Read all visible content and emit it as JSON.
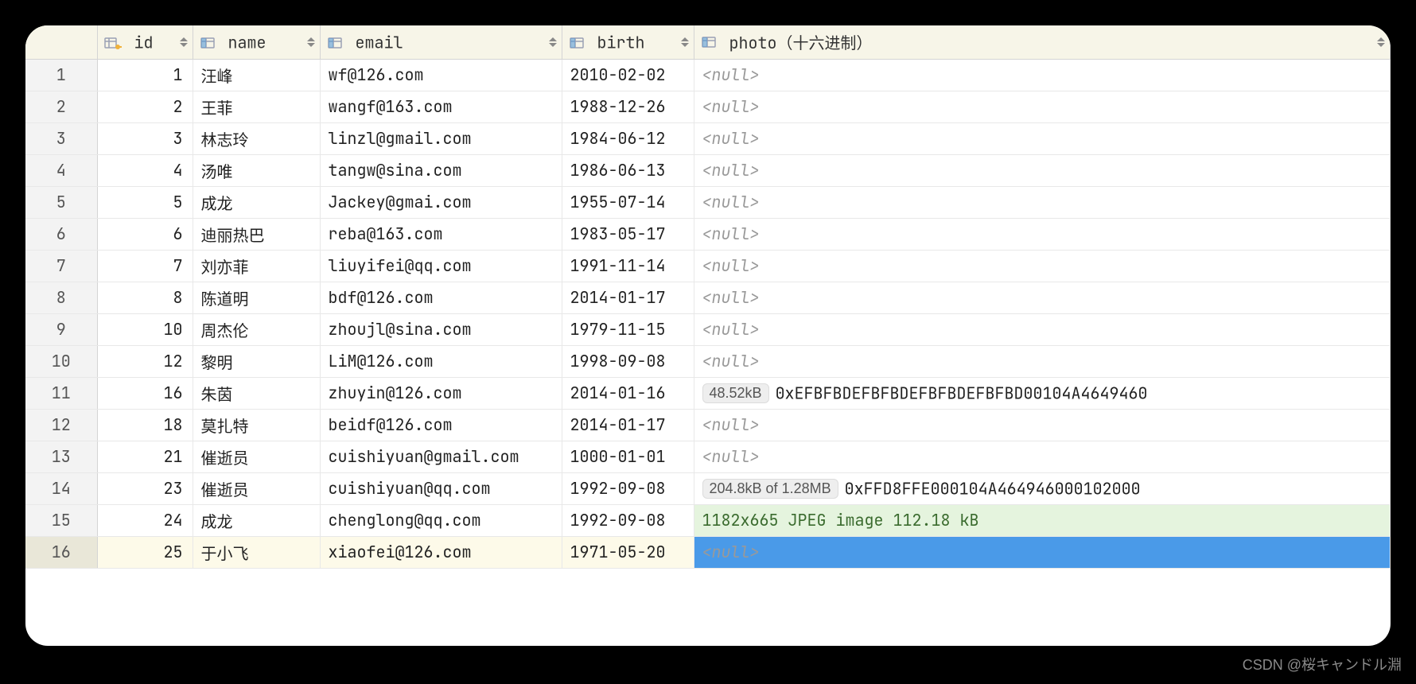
{
  "columns": {
    "id": {
      "label": "id"
    },
    "name": {
      "label": "name"
    },
    "email": {
      "label": "email"
    },
    "birth": {
      "label": "birth"
    },
    "photo": {
      "label": "photo（十六进制）"
    }
  },
  "null_text": "<null>",
  "rows": [
    {
      "n": "1",
      "id": "1",
      "name": "汪峰",
      "email": "wf@126.com",
      "birth": "2010-02-02",
      "photo": null
    },
    {
      "n": "2",
      "id": "2",
      "name": "王菲",
      "email": "wangf@163.com",
      "birth": "1988-12-26",
      "photo": null
    },
    {
      "n": "3",
      "id": "3",
      "name": "林志玲",
      "email": "linzl@gmail.com",
      "birth": "1984-06-12",
      "photo": null
    },
    {
      "n": "4",
      "id": "4",
      "name": "汤唯",
      "email": "tangw@sina.com",
      "birth": "1986-06-13",
      "photo": null
    },
    {
      "n": "5",
      "id": "5",
      "name": "成龙",
      "email": "Jackey@gmai.com",
      "birth": "1955-07-14",
      "photo": null
    },
    {
      "n": "6",
      "id": "6",
      "name": "迪丽热巴",
      "email": "reba@163.com",
      "birth": "1983-05-17",
      "photo": null
    },
    {
      "n": "7",
      "id": "7",
      "name": "刘亦菲",
      "email": "liuyifei@qq.com",
      "birth": "1991-11-14",
      "photo": null
    },
    {
      "n": "8",
      "id": "8",
      "name": "陈道明",
      "email": "bdf@126.com",
      "birth": "2014-01-17",
      "photo": null
    },
    {
      "n": "9",
      "id": "10",
      "name": "周杰伦",
      "email": "zhoujl@sina.com",
      "birth": "1979-11-15",
      "photo": null
    },
    {
      "n": "10",
      "id": "12",
      "name": "黎明",
      "email": "LiM@126.com",
      "birth": "1998-09-08",
      "photo": null
    },
    {
      "n": "11",
      "id": "16",
      "name": "朱茵",
      "email": "zhuyin@126.com",
      "birth": "2014-01-16",
      "photo": {
        "badge": "48.52kB",
        "hex": "0xEFBFBDEFBFBDEFBFBDEFBFBD00104A4649460"
      }
    },
    {
      "n": "12",
      "id": "18",
      "name": "莫扎特",
      "email": "beidf@126.com",
      "birth": "2014-01-17",
      "photo": null
    },
    {
      "n": "13",
      "id": "21",
      "name": "催逝员",
      "email": "cuishiyuan@gmail.com",
      "birth": "1000-01-01",
      "photo": null
    },
    {
      "n": "14",
      "id": "23",
      "name": "催逝员",
      "email": "cuishiyuan@qq.com",
      "birth": "1992-09-08",
      "photo": {
        "badge": "204.8kB of 1.28MB",
        "hex": "0xFFD8FFE000104A464946000102000"
      }
    },
    {
      "n": "15",
      "id": "24",
      "name": "成龙",
      "email": "chenglong@qq.com",
      "birth": "1992-09-08",
      "photo": {
        "image_info": "1182x665 JPEG image 112.18 kB"
      }
    },
    {
      "n": "16",
      "id": "25",
      "name": "于小飞",
      "email": "xiaofei@126.com",
      "birth": "1971-05-20",
      "photo": null,
      "selected": true
    }
  ],
  "watermark": "CSDN @桜キャンドル淵"
}
